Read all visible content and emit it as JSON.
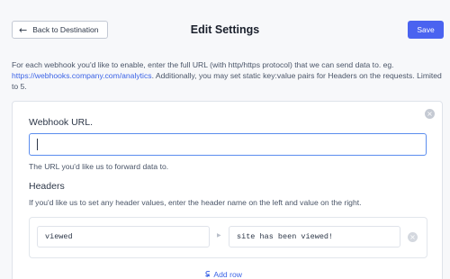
{
  "header": {
    "back_label": "Back to Destination",
    "title": "Edit Settings",
    "save_label": "Save"
  },
  "intro": {
    "text_before": "For each webhook you'd like to enable, enter the full URL (with http/https protocol) that we can send data to. eg.",
    "example_url": "https://webhooks.company.com/analytics",
    "text_after": ". Additionally, you may set static key:value pairs for Headers on the requests. Limited to 5."
  },
  "webhook": {
    "label": "Webhook URL.",
    "value": "",
    "help": "The URL you'd like us to forward data to."
  },
  "headers": {
    "label": "Headers",
    "help": "If you'd like us to set any header values, enter the header name on the left and value on the right.",
    "rows": [
      {
        "key": "viewed",
        "value": "site has been viewed!"
      }
    ],
    "add_row_label": "Add row"
  },
  "icons": {
    "back": "arrow-left-icon",
    "close": "close-circle-icon",
    "separator": "chevron-right-icon",
    "add_row": "add-list-icon"
  },
  "colors": {
    "accent": "#4a63f0",
    "link": "#3b63e6",
    "focus_border": "#5b8dee"
  }
}
